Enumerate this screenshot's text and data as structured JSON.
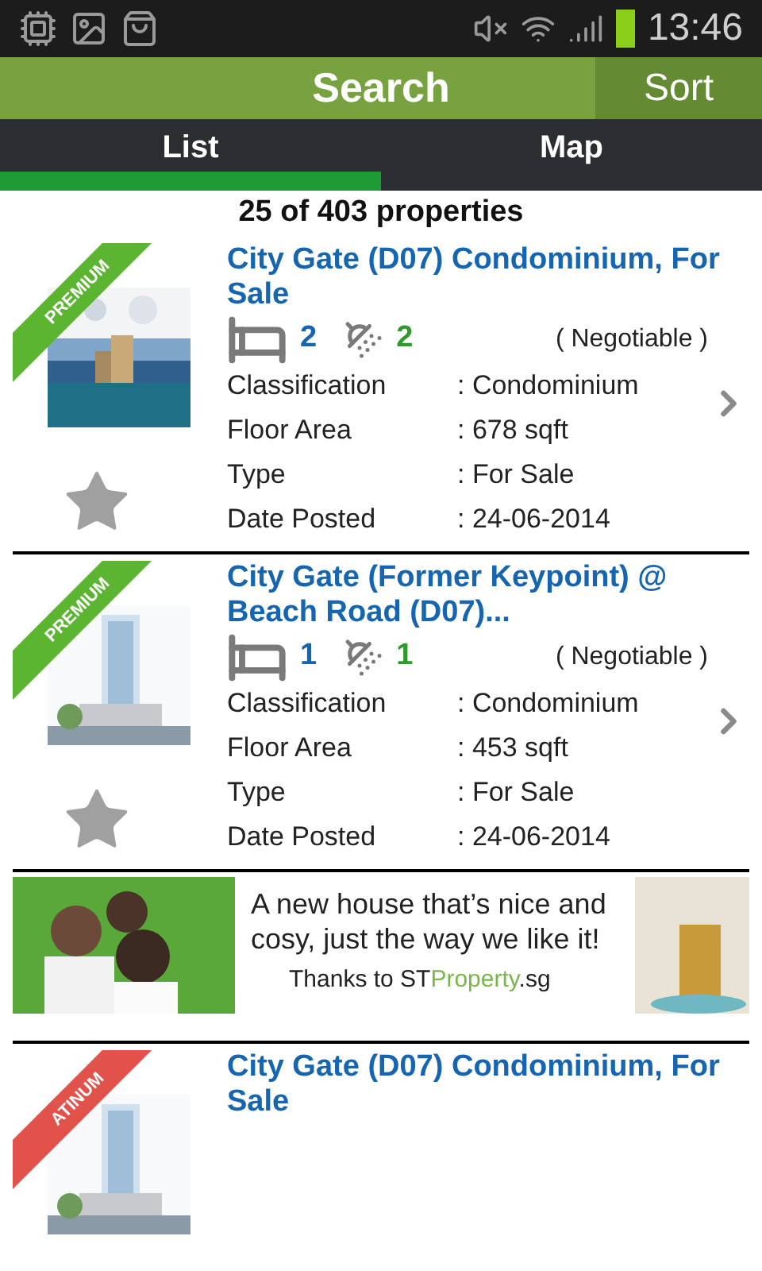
{
  "status_bar": {
    "time": "13:46"
  },
  "header": {
    "title": "Search",
    "sort_button": "Sort"
  },
  "tabs": [
    {
      "label": "List",
      "selected": true
    },
    {
      "label": "Map",
      "selected": false
    }
  ],
  "count": "25 of 403 properties",
  "listings": [
    {
      "badge": "PREMIUM",
      "color": "#5cb531",
      "title": "City Gate (D07) Condominium, For Sale",
      "bedrooms": "2",
      "bathrooms": "2",
      "price": "( Negotiable )",
      "favorite": false,
      "details": [
        {
          "label": "Classification",
          "value": ": Condominium"
        },
        {
          "label": "Floor Area",
          "value": ": 678 sqft"
        },
        {
          "label": "Type",
          "value": ": For Sale"
        },
        {
          "label": "Date Posted",
          "value": ": 24-06-2014"
        }
      ]
    },
    {
      "badge": "PREMIUM",
      "color": "#5cb531",
      "title": "City Gate (Former Keypoint) @ Beach Road (D07)...",
      "bedrooms": "1",
      "bathrooms": "1",
      "price": "( Negotiable )",
      "favorite": false,
      "details": [
        {
          "label": "Classification",
          "value": ": Condominium"
        },
        {
          "label": "Floor Area",
          "value": ": 453 sqft"
        },
        {
          "label": "Type",
          "value": ": For Sale"
        },
        {
          "label": "Date Posted",
          "value": ": 24-06-2014"
        }
      ]
    },
    {
      "kind": "ad",
      "lines": [
        "A new house that’s nice and",
        "cosy, just the way we like it!"
      ],
      "tagline": "Thanks to ST",
      "brand": "Property",
      "suffix": ".sg"
    },
    {
      "badge": "ATINUM",
      "color": "#e0524a",
      "title": "City Gate (D07) Condominium, For Sale"
    }
  ]
}
